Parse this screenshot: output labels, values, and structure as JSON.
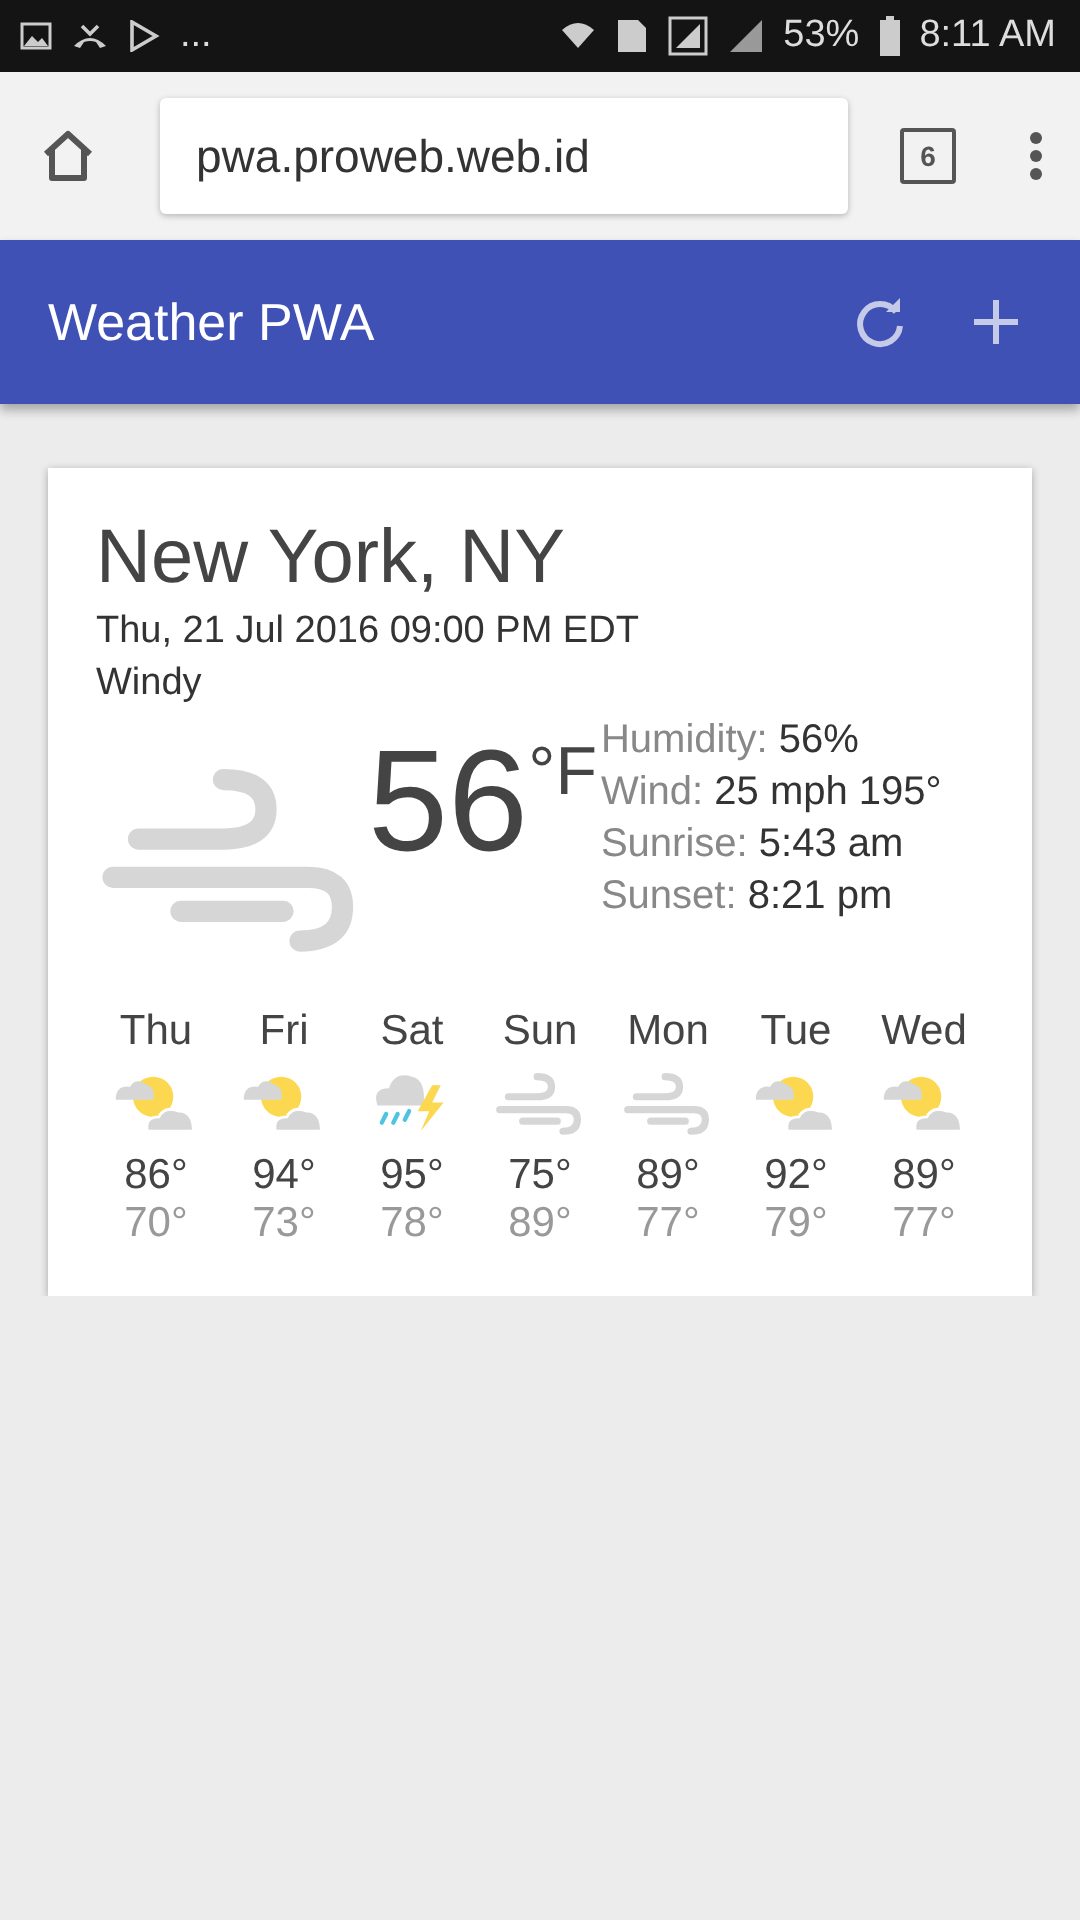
{
  "status_bar": {
    "more": "...",
    "battery": "53%",
    "time": "8:11 AM"
  },
  "browser": {
    "url": "pwa.proweb.web.id",
    "tab_count": "6"
  },
  "header": {
    "title": "Weather PWA"
  },
  "card": {
    "location": "New York, NY",
    "date": "Thu, 21 Jul 2016 09:00 PM EDT",
    "description": "Windy",
    "kind": "windy",
    "temperature": "56",
    "unit": "°F",
    "details": [
      {
        "label": "Humidity:",
        "value": "56%"
      },
      {
        "label": "Wind:",
        "value": "25 mph 195°"
      },
      {
        "label": "Sunrise:",
        "value": "5:43 am"
      },
      {
        "label": "Sunset:",
        "value": "8:21 pm"
      }
    ],
    "forecast": [
      {
        "day": "Thu",
        "kind": "partly-cloudy",
        "high": "86°",
        "low": "70°"
      },
      {
        "day": "Fri",
        "kind": "partly-cloudy",
        "high": "94°",
        "low": "73°"
      },
      {
        "day": "Sat",
        "kind": "thunderstorm",
        "high": "95°",
        "low": "78°"
      },
      {
        "day": "Sun",
        "kind": "windy",
        "high": "75°",
        "low": "89°"
      },
      {
        "day": "Mon",
        "kind": "windy",
        "high": "89°",
        "low": "77°"
      },
      {
        "day": "Tue",
        "kind": "partly-cloudy",
        "high": "92°",
        "low": "79°"
      },
      {
        "day": "Wed",
        "kind": "partly-cloudy",
        "high": "89°",
        "low": "77°"
      }
    ]
  }
}
